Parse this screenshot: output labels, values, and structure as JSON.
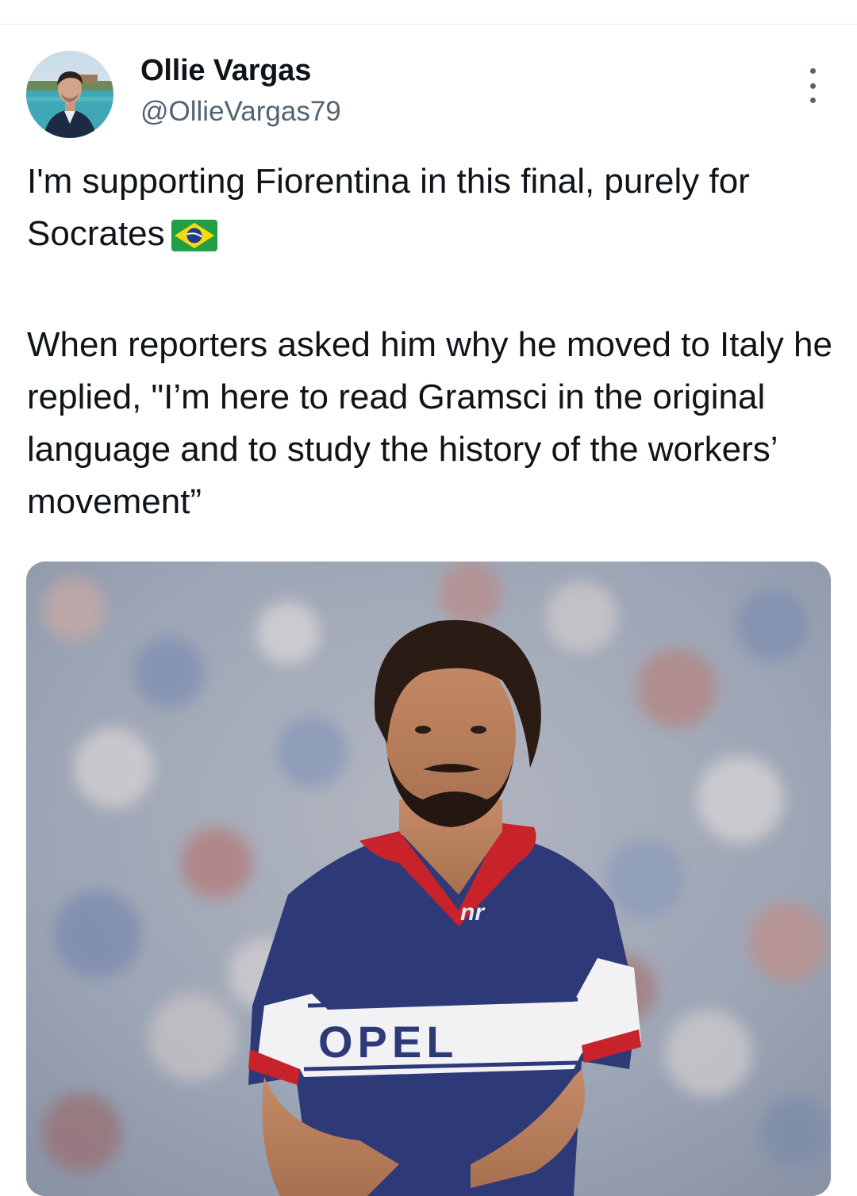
{
  "tweet": {
    "author": {
      "display_name": "Ollie Vargas",
      "handle": "@OllieVargas79",
      "avatar_icon": "profile-photo"
    },
    "text": {
      "paragraph_1": "I'm supporting Fiorentina in this final, purely for Socrates",
      "flag_emoji": "brazil-flag-emoji",
      "paragraph_2": "When reporters asked him why he moved to Italy he replied, \"I’m here to read Gramsci in the original language and to study the history of the workers’ movement”"
    },
    "media": {
      "shirt_text": "OPEL",
      "shirt_logo_text": "nr"
    },
    "more_icon": "more-vertical-icon"
  },
  "colors": {
    "text_primary": "#0f1419",
    "text_secondary": "#536471",
    "shirt_navy": "#2e3a78",
    "shirt_red": "#c8222b"
  }
}
